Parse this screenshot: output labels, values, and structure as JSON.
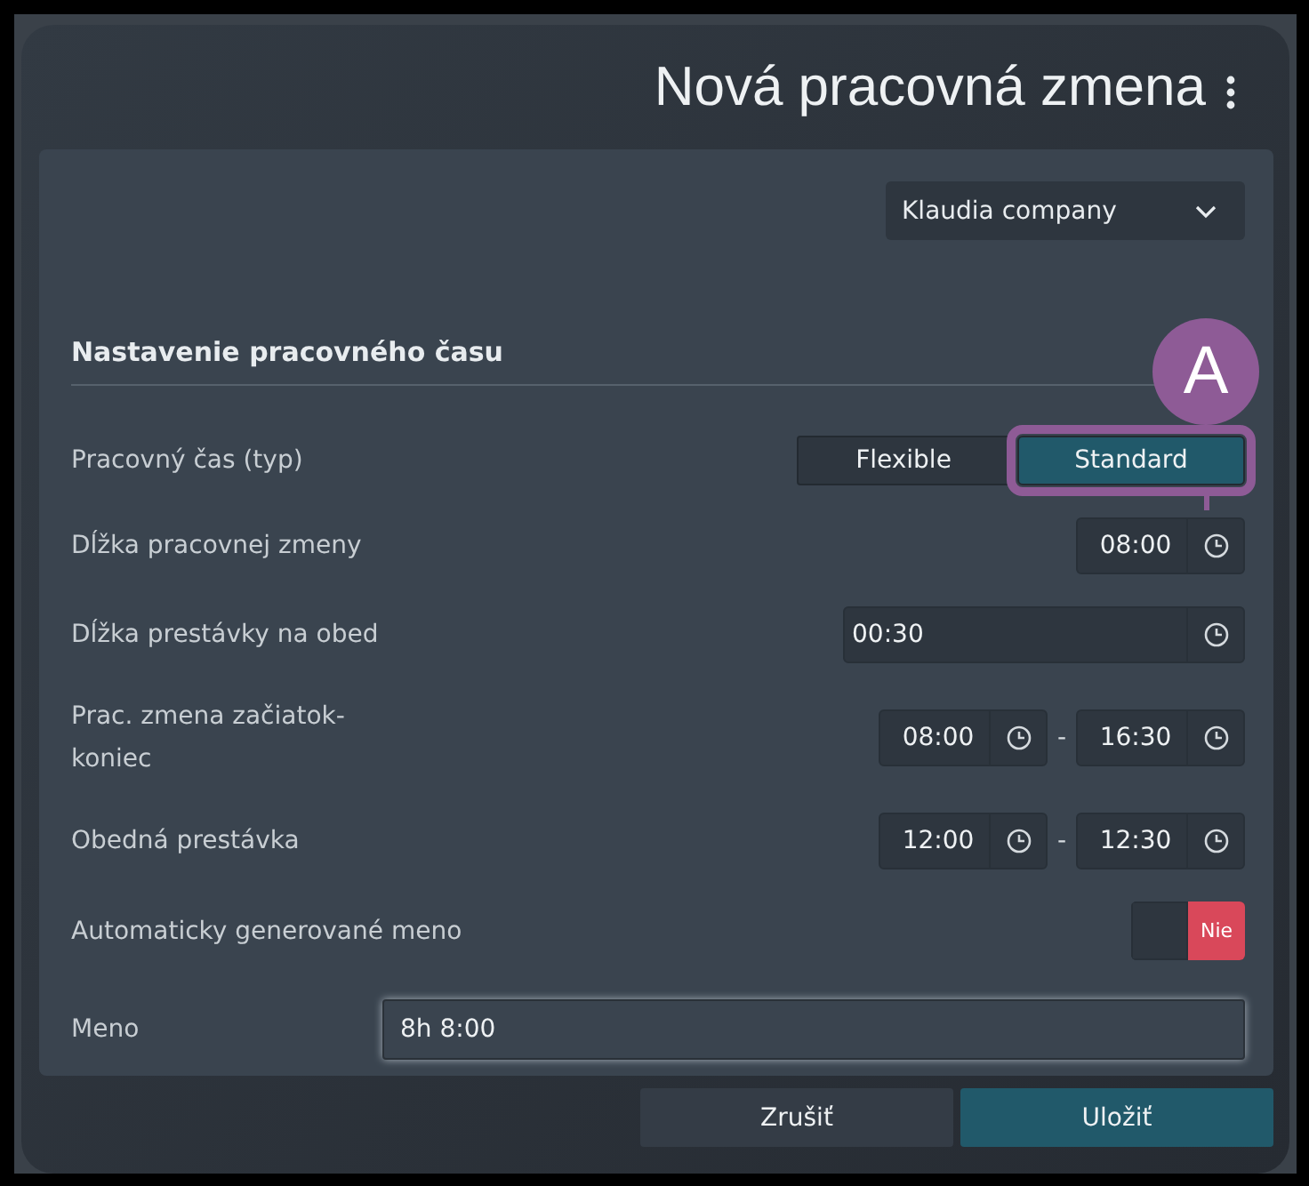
{
  "dialog": {
    "title": "Nová pracovná zmena",
    "company": {
      "value": "Klaudia company"
    },
    "section_title": "Nastavenie pracovného času",
    "fields": [
      {
        "kind": "segmented",
        "label": "Pracovný čas (typ)",
        "options": [
          {
            "label": "Flexible",
            "selected": false
          },
          {
            "label": "Standard",
            "selected": true,
            "annotation": "A"
          }
        ]
      },
      {
        "kind": "time",
        "label": "Dĺžka pracovnej zmeny",
        "values": [
          "08:00"
        ]
      },
      {
        "kind": "time_wide",
        "label": "Dĺžka prestávky na obed",
        "values": [
          "00:30"
        ]
      },
      {
        "kind": "range",
        "label": "Prac. zmena začiatok-koniec",
        "values": [
          "08:00",
          "16:30"
        ],
        "separator": "-"
      },
      {
        "kind": "range",
        "label": "Obedná prestávka",
        "values": [
          "12:00",
          "12:30"
        ],
        "separator": "-"
      },
      {
        "kind": "toggle",
        "label": "Automaticky generované meno",
        "on": false,
        "state_label": "Nie"
      },
      {
        "kind": "text",
        "label": "Meno",
        "value": "8h 8:00"
      }
    ],
    "buttons": [
      {
        "label": "Zrušiť",
        "kind": "secondary"
      },
      {
        "label": "Uložiť",
        "kind": "primary"
      }
    ]
  }
}
